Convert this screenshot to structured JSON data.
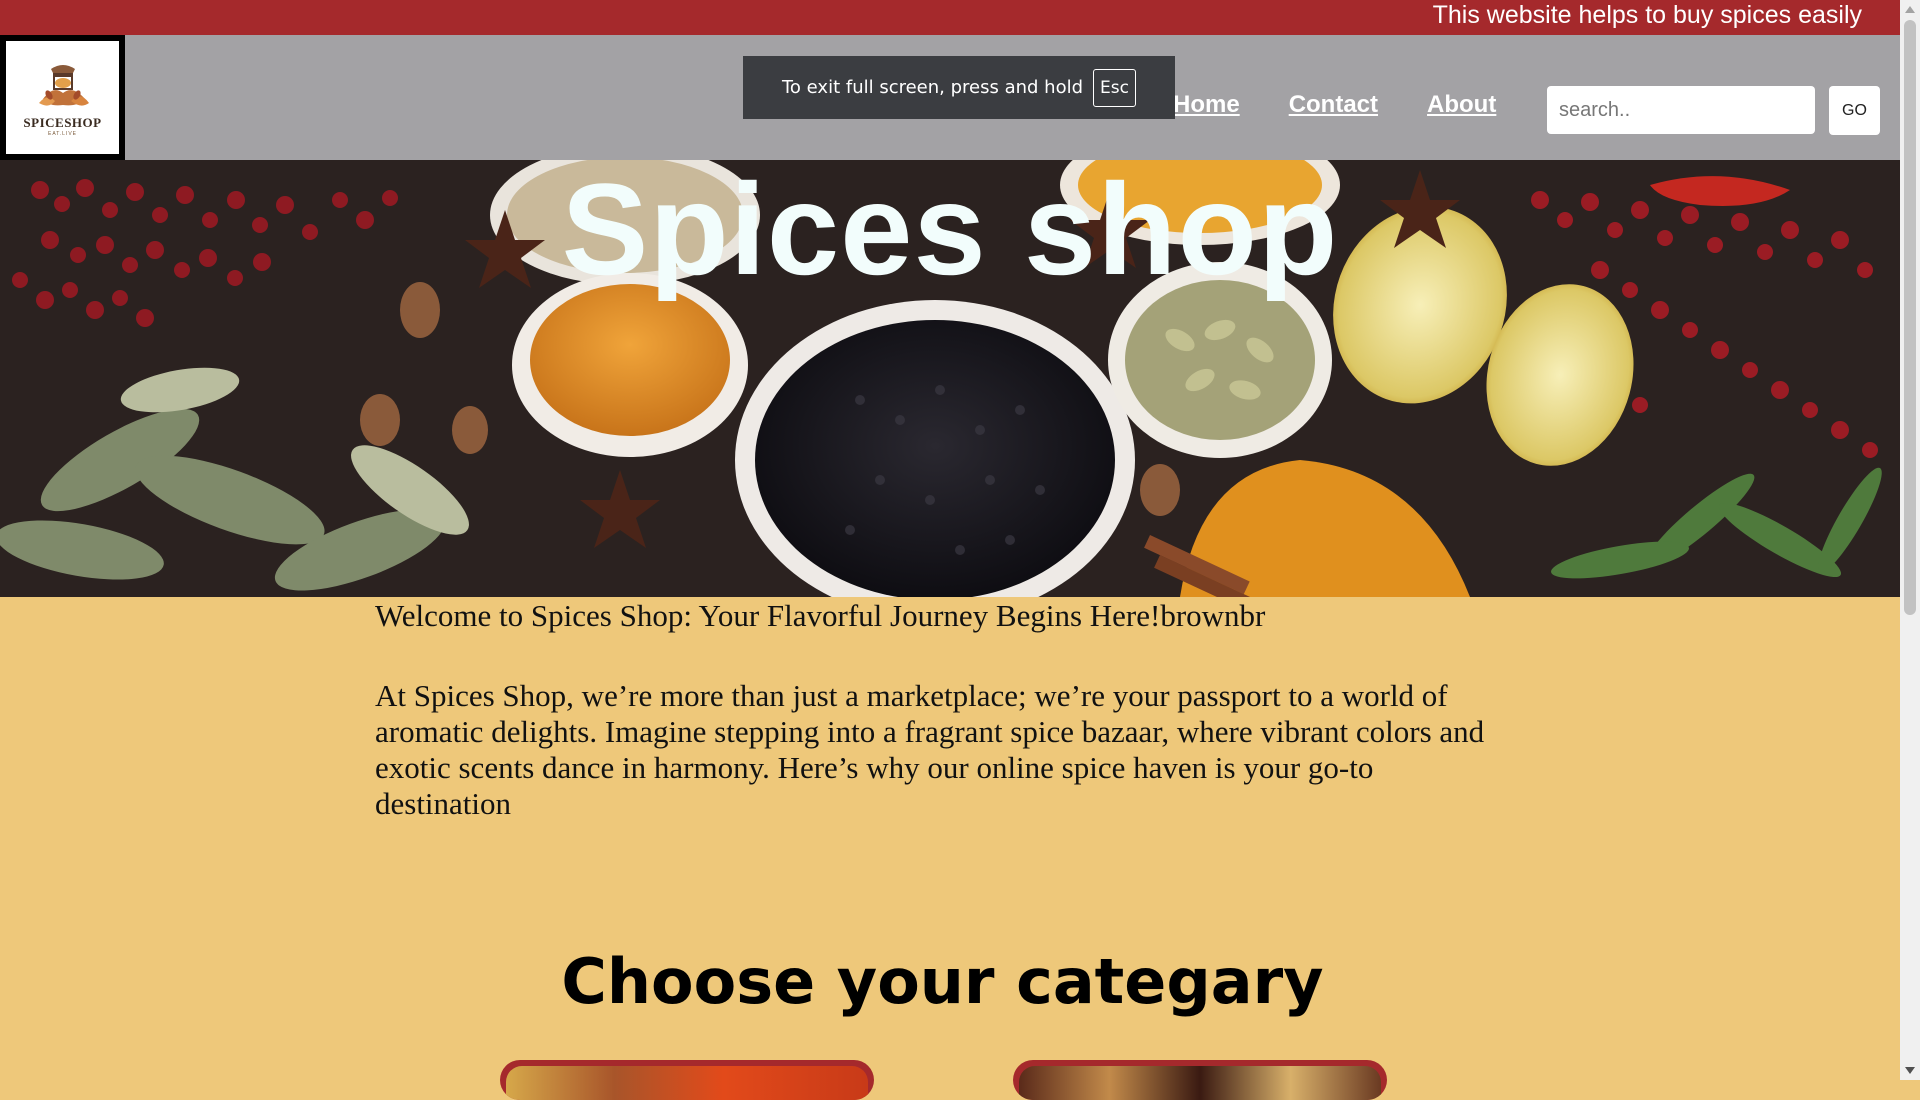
{
  "topbar": {
    "marquee_text": "This website helps to buy spices easily"
  },
  "logo": {
    "name": "SPICESHOP",
    "tagline": "EAT.LIVE"
  },
  "nav": {
    "items": [
      {
        "label": "Home"
      },
      {
        "label": "Contact"
      },
      {
        "label": "About"
      }
    ]
  },
  "search": {
    "placeholder": "search..",
    "button_label": "GO"
  },
  "fullscreen_toast": {
    "text": "To exit full screen, press and hold",
    "key": "Esc"
  },
  "hero": {
    "title": "Spices shop"
  },
  "content": {
    "welcome": "Welcome to Spices Shop: Your Flavorful Journey Begins Here!brownbr",
    "intro": "At Spices Shop, we’re more than just a marketplace; we’re your passport to a world of aromatic delights. Imagine stepping into a fragrant spice bazaar, where vibrant colors and exotic scents dance in harmony. Here’s why our online spice haven is your go-to destination",
    "category_heading": "Choose your categary"
  },
  "colors": {
    "topbar": "#a5292c",
    "header": "#a3a2a5",
    "page_background": "#eec87a",
    "card_border": "#a5292c"
  }
}
